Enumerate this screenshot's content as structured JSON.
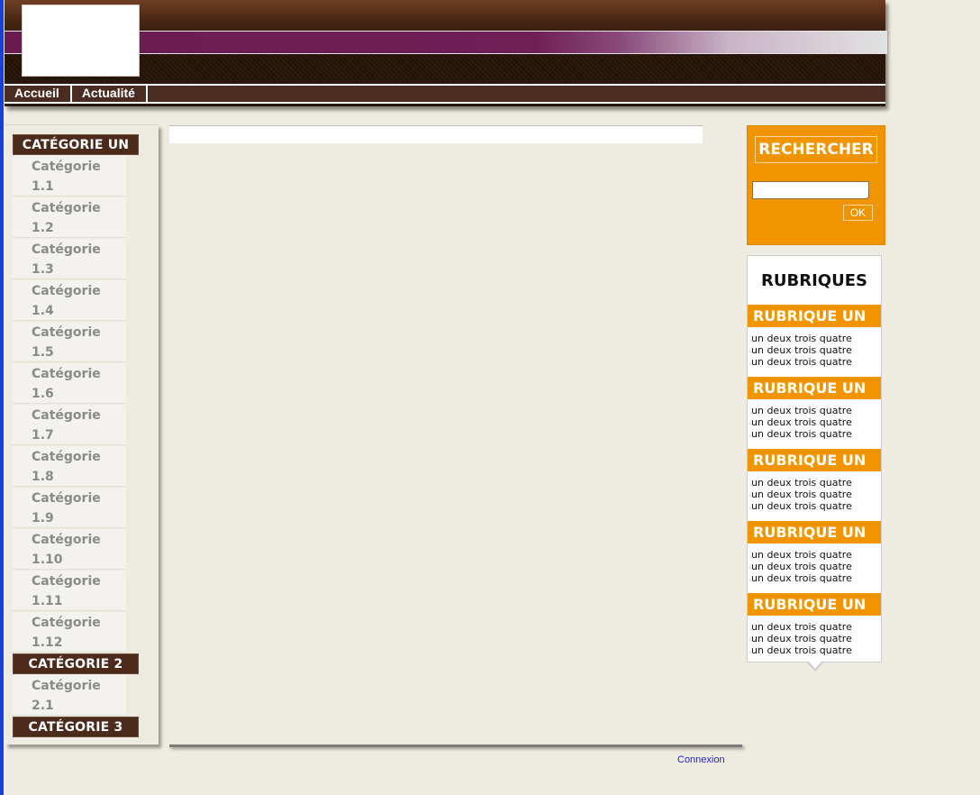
{
  "nav": {
    "items": [
      "Accueil",
      "Actualité"
    ]
  },
  "sidebar": {
    "groups": [
      {
        "title": "CATÉGORIE UN",
        "items": [
          [
            "Catégorie",
            "1.1"
          ],
          [
            "Catégorie",
            "1.2"
          ],
          [
            "Catégorie",
            "1.3"
          ],
          [
            "Catégorie",
            "1.4"
          ],
          [
            "Catégorie",
            "1.5"
          ],
          [
            "Catégorie",
            "1.6"
          ],
          [
            "Catégorie",
            "1.7"
          ],
          [
            "Catégorie",
            "1.8"
          ],
          [
            "Catégorie",
            "1.9"
          ],
          [
            "Catégorie",
            "1.10"
          ],
          [
            "Catégorie",
            "1.11"
          ],
          [
            "Catégorie",
            "1.12"
          ]
        ]
      },
      {
        "title": "CATÉGORIE 2",
        "items": [
          [
            "Catégorie",
            "2.1"
          ]
        ]
      },
      {
        "title": "CATÉGORIE 3",
        "items": []
      }
    ]
  },
  "search": {
    "title": "RECHERCHER",
    "input_value": "",
    "button_label": "OK"
  },
  "rubriques": {
    "title": "RUBRIQUES",
    "sections": [
      {
        "title": "RUBRIQUE UN",
        "lines": [
          "un deux trois quatre",
          "un deux trois quatre",
          "un deux trois quatre"
        ]
      },
      {
        "title": "RUBRIQUE UN",
        "lines": [
          "un deux trois quatre",
          "un deux trois quatre",
          "un deux trois quatre"
        ]
      },
      {
        "title": "RUBRIQUE UN",
        "lines": [
          "un deux trois quatre",
          "un deux trois quatre",
          "un deux trois quatre"
        ]
      },
      {
        "title": "RUBRIQUE UN",
        "lines": [
          "un deux trois quatre",
          "un deux trois quatre",
          "un deux trois quatre"
        ]
      },
      {
        "title": "RUBRIQUE UN",
        "lines": [
          "un deux trois quatre",
          "un deux trois quatre",
          "un deux trois quatre"
        ]
      }
    ]
  },
  "footer": {
    "login_label": "Connexion"
  }
}
